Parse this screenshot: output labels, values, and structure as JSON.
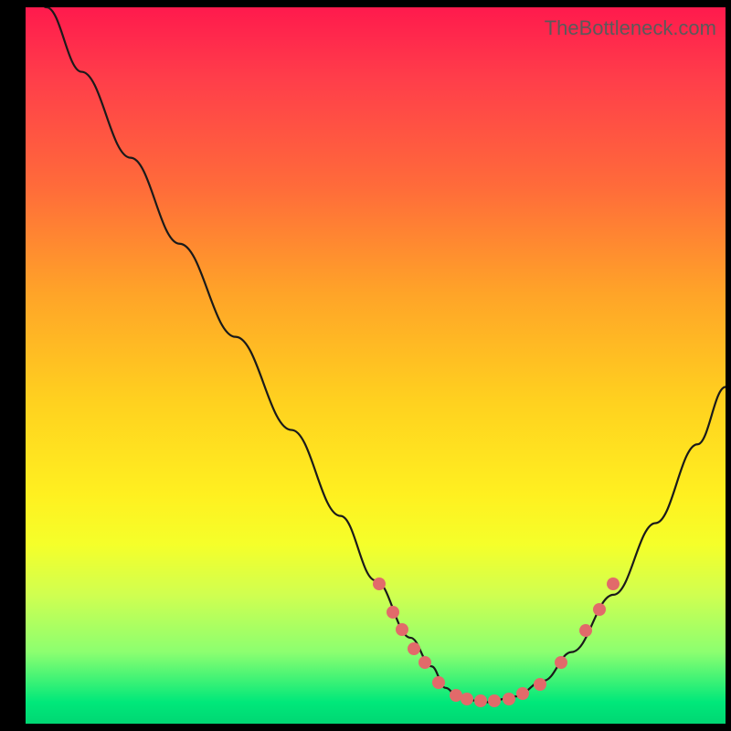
{
  "watermark": "TheBottleneck.com",
  "chart_data": {
    "type": "line",
    "title": "",
    "xlabel": "",
    "ylabel": "",
    "xlim": [
      0,
      100
    ],
    "ylim": [
      0,
      100
    ],
    "series": [
      {
        "name": "curve",
        "x": [
          0,
          3,
          8,
          15,
          22,
          30,
          38,
          45,
          50,
          55,
          58,
          60,
          62,
          66,
          70,
          74,
          78,
          84,
          90,
          96,
          100
        ],
        "values": [
          104,
          100,
          91,
          79,
          67,
          54,
          41,
          29,
          20,
          12,
          8,
          5,
          3.5,
          3,
          3.8,
          6,
          10,
          18,
          28,
          39,
          47
        ]
      }
    ],
    "points": [
      {
        "x": 50.5,
        "y": 19.5
      },
      {
        "x": 52.5,
        "y": 15.5
      },
      {
        "x": 53.8,
        "y": 13.2
      },
      {
        "x": 55.5,
        "y": 10.5
      },
      {
        "x": 57.0,
        "y": 8.5
      },
      {
        "x": 59.0,
        "y": 5.8
      },
      {
        "x": 61.5,
        "y": 4.0
      },
      {
        "x": 63.0,
        "y": 3.5
      },
      {
        "x": 65.0,
        "y": 3.2
      },
      {
        "x": 67.0,
        "y": 3.2
      },
      {
        "x": 69.0,
        "y": 3.5
      },
      {
        "x": 71.0,
        "y": 4.2
      },
      {
        "x": 73.5,
        "y": 5.5
      },
      {
        "x": 76.5,
        "y": 8.5
      },
      {
        "x": 80.0,
        "y": 13.0
      },
      {
        "x": 82.0,
        "y": 16.0
      },
      {
        "x": 84.0,
        "y": 19.5
      }
    ]
  },
  "colors": {
    "dot": "#e26a6a",
    "curve": "#1a1a1a"
  }
}
